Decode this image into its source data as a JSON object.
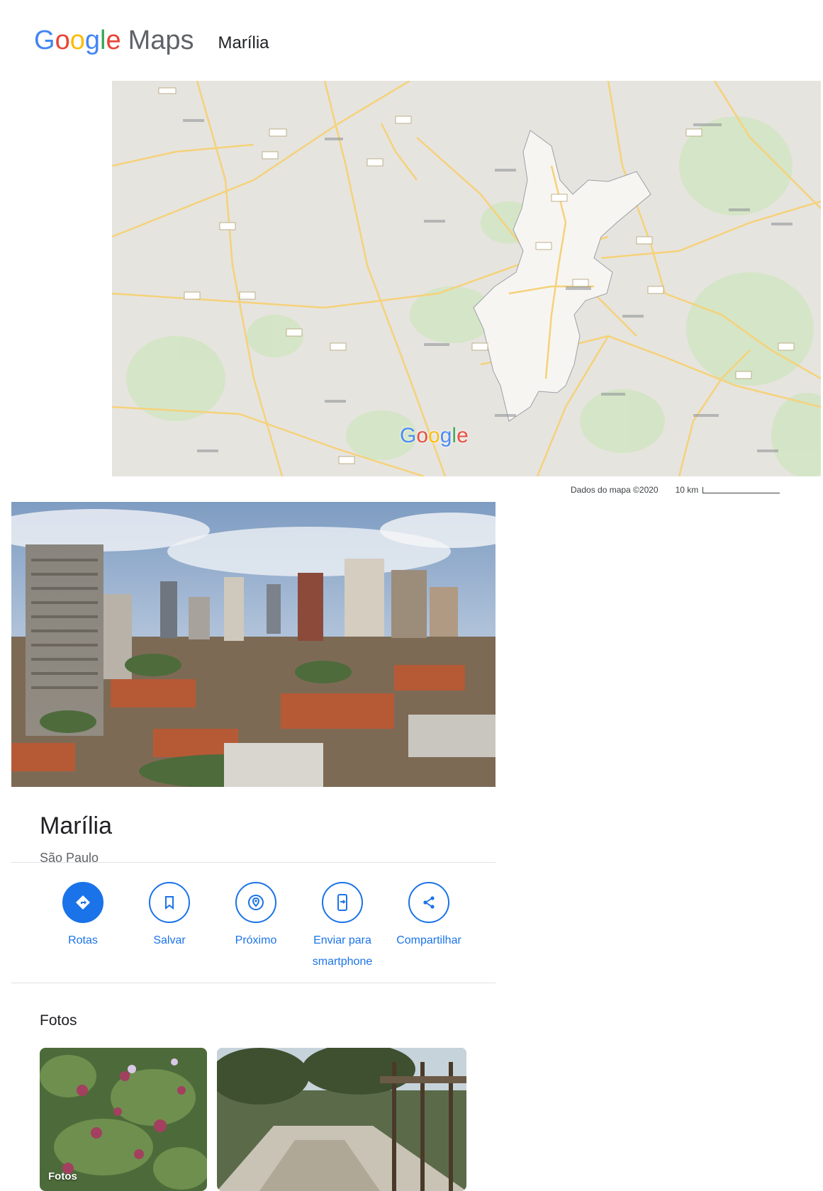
{
  "header": {
    "logo_letters": [
      "G",
      "o",
      "o",
      "g",
      "l",
      "e"
    ],
    "logo_product": "Maps",
    "place": "Marília"
  },
  "map": {
    "watermark_letters": [
      "G",
      "o",
      "o",
      "g",
      "l",
      "e"
    ],
    "attribution": "Dados do mapa ©2020",
    "scale": "10 km",
    "colors": {
      "land": "#e6e4df",
      "region_fill": "#f7f5f1",
      "road": "#f5d27a",
      "vegetation": "#cfe3c0"
    }
  },
  "place": {
    "name": "Marília",
    "region": "São Paulo"
  },
  "actions": [
    {
      "label": "Rotas",
      "icon": "directions-icon",
      "primary": true
    },
    {
      "label": "Salvar",
      "icon": "bookmark-icon",
      "primary": false
    },
    {
      "label": "Próximo",
      "icon": "nearby-icon",
      "primary": false
    },
    {
      "label": "Enviar para smartphone",
      "icon": "send-to-phone-icon",
      "primary": false
    },
    {
      "label": "Compartilhar",
      "icon": "share-icon",
      "primary": false
    }
  ],
  "photos": {
    "title": "Fotos",
    "items": [
      {
        "label": "Fotos",
        "subject": "flowers-photo"
      },
      {
        "label": "",
        "subject": "park-path-photo"
      }
    ]
  },
  "theme": {
    "accent": "#1a73e8"
  }
}
